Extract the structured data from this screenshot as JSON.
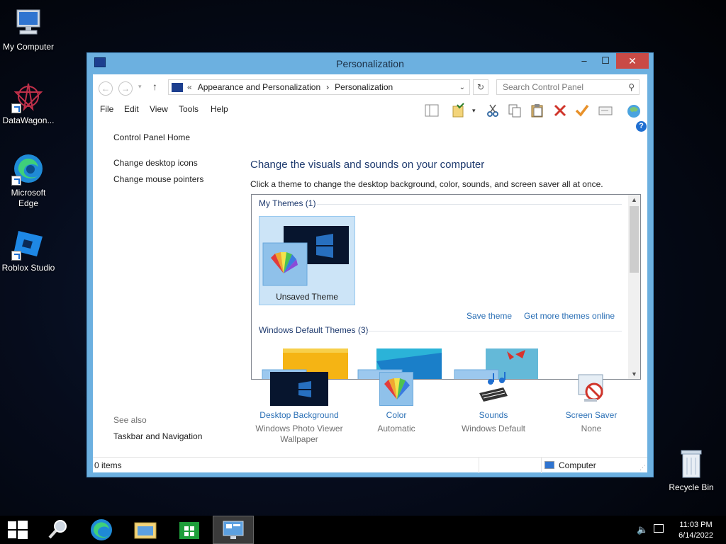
{
  "desktop": {
    "icons": [
      {
        "label": "My Computer"
      },
      {
        "label": "DataWagon..."
      },
      {
        "label": "Microsoft Edge"
      },
      {
        "label": "Roblox Studio"
      },
      {
        "label": "Recycle Bin"
      }
    ]
  },
  "window": {
    "title": "Personalization",
    "controls": {
      "minimize": "–",
      "maximize": "☐",
      "close": "✕"
    }
  },
  "address": {
    "chevron": "«",
    "crumbs": [
      "Appearance and Personalization",
      "Personalization"
    ],
    "separator": "›",
    "search_placeholder": "Search Control Panel"
  },
  "menu": [
    "File",
    "Edit",
    "View",
    "Tools",
    "Help"
  ],
  "left_pane": {
    "home": "Control Panel Home",
    "links": [
      "Change desktop icons",
      "Change mouse pointers"
    ],
    "see_also": "See also",
    "see_also_links": [
      "Taskbar and Navigation"
    ]
  },
  "main": {
    "headline": "Change the visuals and sounds on your computer",
    "description": "Click a theme to change the desktop background, color, sounds, and screen saver all at once.",
    "my_themes_header": "My Themes (1)",
    "unsaved_theme": "Unsaved Theme",
    "save_theme": "Save theme",
    "get_more": "Get more themes online",
    "default_header": "Windows Default Themes (3)"
  },
  "settings": [
    {
      "label": "Desktop Background",
      "value": "Windows Photo Viewer Wallpaper",
      "icon": "desktop-background-icon"
    },
    {
      "label": "Color",
      "value": "Automatic",
      "icon": "color-icon"
    },
    {
      "label": "Sounds",
      "value": "Windows Default",
      "icon": "sounds-icon"
    },
    {
      "label": "Screen Saver",
      "value": "None",
      "icon": "screen-saver-icon"
    }
  ],
  "status": {
    "items": "0 items",
    "location": "Computer"
  },
  "taskbar": {
    "time": "11:03 PM",
    "date": "6/14/2022"
  },
  "colors": {
    "accent": "#6cb0e0",
    "link": "#2a6fb5",
    "heading": "#1e3a6e",
    "close": "#c94a46"
  }
}
